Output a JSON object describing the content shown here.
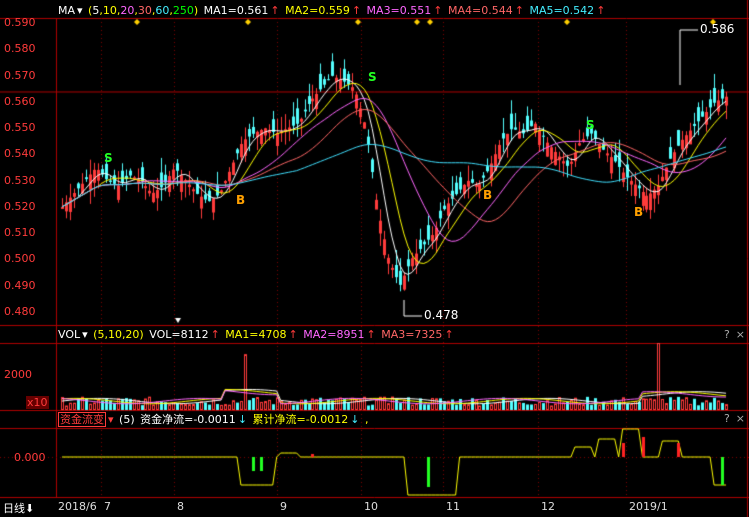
{
  "main_header": {
    "name": "MA",
    "params": "(5,10,20,30,60,250)",
    "params_parts": [
      "5",
      "10",
      "20",
      "30",
      "60",
      "250"
    ],
    "ma1": "MA1=0.561",
    "ma2": "MA2=0.559",
    "ma3": "MA3=0.551",
    "ma4": "MA4=0.544",
    "ma5": "MA5=0.542"
  },
  "vol_header": {
    "name": "VOL",
    "params": "(5,10,20)",
    "vol": "VOL=8112",
    "ma1": "MA1=4708",
    "ma2": "MA2=8951",
    "ma3": "MA3=7325"
  },
  "flow_header": {
    "name": "资金流变",
    "params": "(5)",
    "net": "资金净流=-0.0011",
    "cum": "累计净流=-0.0012",
    "tail": ","
  },
  "panel_buttons": [
    "?",
    "×"
  ],
  "price_axis": [
    "0.590",
    "0.580",
    "0.570",
    "0.560",
    "0.550",
    "0.540",
    "0.530",
    "0.520",
    "0.510",
    "0.500",
    "0.490",
    "0.480"
  ],
  "vol_axis": [
    "2000",
    "x10"
  ],
  "flow_axis": [
    "0.000"
  ],
  "x_axis": {
    "period": "日线",
    "labels": [
      "2018/6",
      "7",
      "8",
      "9",
      "10",
      "11",
      "12",
      "2019/1"
    ]
  },
  "annotations": {
    "high": "0.586",
    "low": "0.478",
    "signals": [
      {
        "type": "S"
      },
      {
        "type": "B"
      },
      {
        "type": "S"
      },
      {
        "type": "B"
      },
      {
        "type": "S"
      },
      {
        "type": "B"
      }
    ]
  },
  "colors": {
    "up": "#ff3b3b",
    "down": "#54ffff",
    "ma1": "#ffffff",
    "ma2": "#ffff00",
    "ma3": "#ff66ff",
    "ma4": "#ff6666",
    "ma5": "#40e0ff",
    "signal_s": "#22ff22",
    "signal_b": "#ffa000"
  },
  "chart_data": {
    "type": "candlestick",
    "ylim": [
      0.475,
      0.592
    ],
    "high": 0.586,
    "low": 0.478,
    "close_path": [
      0.52,
      0.525,
      0.53,
      0.535,
      0.53,
      0.528,
      0.532,
      0.53,
      0.525,
      0.528,
      0.535,
      0.53,
      0.525,
      0.522,
      0.525,
      0.535,
      0.545,
      0.548,
      0.55,
      0.548,
      0.55,
      0.552,
      0.56,
      0.565,
      0.57,
      0.568,
      0.565,
      0.55,
      0.52,
      0.5,
      0.49,
      0.5,
      0.505,
      0.51,
      0.52,
      0.525,
      0.53,
      0.528,
      0.535,
      0.545,
      0.55,
      0.548,
      0.552,
      0.545,
      0.54,
      0.535,
      0.545,
      0.548,
      0.542,
      0.538,
      0.532,
      0.528,
      0.524,
      0.528,
      0.538,
      0.545,
      0.55,
      0.555,
      0.56,
      0.562
    ]
  }
}
